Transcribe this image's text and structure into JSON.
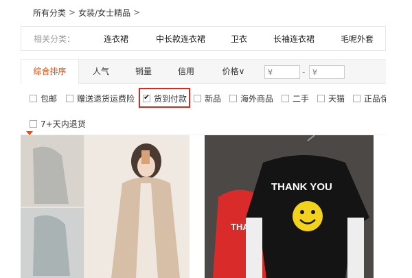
{
  "breadcrumb": {
    "root": "所有分类",
    "sep": ">",
    "current": "女装/女士精品",
    "trail": ">"
  },
  "related": {
    "label": "相关分类：",
    "links": [
      "连衣裙",
      "中长款连衣裙",
      "卫衣",
      "长袖连衣裙",
      "毛呢外套"
    ]
  },
  "sort": {
    "tabs": [
      "综合排序",
      "人气",
      "销量",
      "信用",
      "价格∨"
    ],
    "price_min_placeholder": "¥",
    "price_max_placeholder": "¥",
    "dash": "-"
  },
  "filters": [
    {
      "label": "包邮",
      "checked": false
    },
    {
      "label": "赠送退货运费险",
      "checked": false
    },
    {
      "label": "货到付款",
      "checked": true
    },
    {
      "label": "新品",
      "checked": false
    },
    {
      "label": "海外商品",
      "checked": false
    },
    {
      "label": "二手",
      "checked": false
    },
    {
      "label": "天猫",
      "checked": false
    },
    {
      "label": "正品保",
      "checked": false
    },
    {
      "label": "7+天内退货",
      "checked": false
    }
  ],
  "products": [
    {
      "image": "woman-in-beige-coat-photo"
    },
    {
      "image": "thank-you-smiley-sweatshirt-photo",
      "shirt_text": "THANK YOU",
      "shirt_text_partial": "THA"
    }
  ],
  "colors": {
    "accent": "#ff4400",
    "highlight": "#e0251b"
  }
}
